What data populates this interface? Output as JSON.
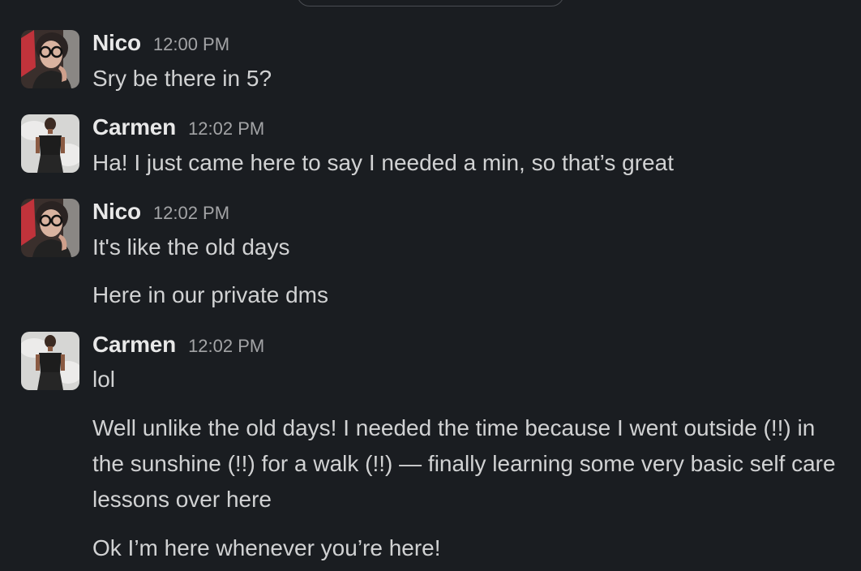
{
  "messages": [
    {
      "sender": "Nico",
      "time": "12:00 PM",
      "avatar_icon": "nico-avatar-icon",
      "lines": [
        "Sry be there in 5?"
      ]
    },
    {
      "sender": "Carmen",
      "time": "12:02 PM",
      "avatar_icon": "carmen-avatar-icon",
      "lines": [
        "Ha! I just came here to say I needed a min, so that’s great"
      ]
    },
    {
      "sender": "Nico",
      "time": "12:02 PM",
      "avatar_icon": "nico-avatar-icon",
      "lines": [
        "It's like the old days",
        "Here in our private dms"
      ]
    },
    {
      "sender": "Carmen",
      "time": "12:02 PM",
      "avatar_icon": "carmen-avatar-icon",
      "lines": [
        "lol",
        "Well unlike the old days! I needed the time because I went outside (!!) in the sunshine (!!) for a walk (!!) — finally learning some very basic self care lessons over here",
        "Ok I’m here whenever you’re here!"
      ]
    }
  ],
  "colors": {
    "background": "#1a1d21",
    "sender": "#e8e8e8",
    "text": "#d1d2d3",
    "timestamp": "#a3a4a6"
  }
}
